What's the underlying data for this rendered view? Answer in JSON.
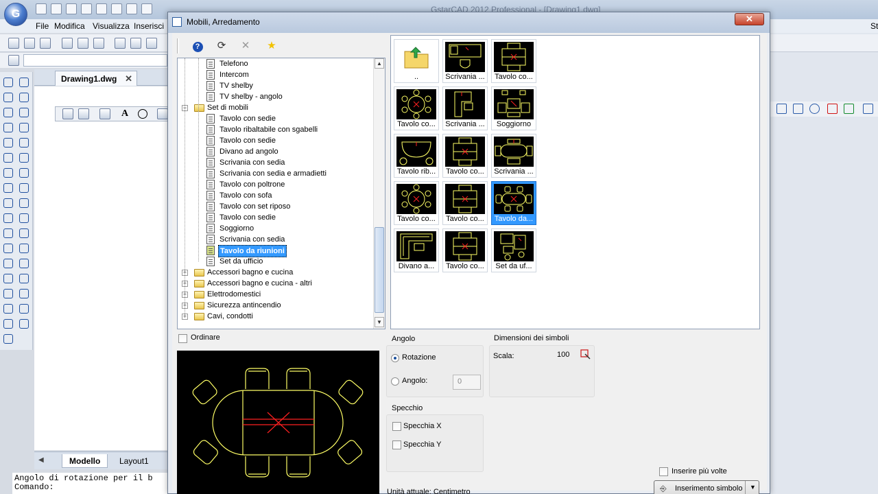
{
  "app": {
    "title": "GstarCAD 2012 Professional - [Drawing1.dwg]",
    "menu": [
      "File",
      "Modifica",
      "Visualizza",
      "Inserisci"
    ],
    "menu_right": "St",
    "doc_tab": "Drawing1.dwg",
    "doc_tab_close": "✕",
    "layout_tabs": [
      "Modello",
      "Layout1"
    ],
    "command_lines": [
      "Angolo di rotazione per il b",
      "Comando:"
    ]
  },
  "dialog": {
    "title": "Mobili, Arredamento",
    "close_label": "✕",
    "toolbar": {
      "help": "?",
      "reload": "⟳",
      "delete": "✕",
      "favorite": "★"
    },
    "tree": {
      "rows": [
        {
          "label": "Telefono",
          "type": "leaf",
          "level": 2
        },
        {
          "label": "Intercom",
          "type": "leaf",
          "level": 2
        },
        {
          "label": "TV shelby",
          "type": "leaf",
          "level": 2
        },
        {
          "label": "TV shelby - angolo",
          "type": "leaf",
          "level": 2
        },
        {
          "label": "Set di mobili",
          "type": "folder-open",
          "level": 1
        },
        {
          "label": "Tavolo con sedie",
          "type": "leaf",
          "level": 2
        },
        {
          "label": "Tavolo ribaltabile con sgabelli",
          "type": "leaf",
          "level": 2
        },
        {
          "label": "Tavolo con sedie",
          "type": "leaf",
          "level": 2
        },
        {
          "label": "Divano ad angolo",
          "type": "leaf",
          "level": 2
        },
        {
          "label": "Scrivania con sedia",
          "type": "leaf",
          "level": 2
        },
        {
          "label": "Scrivania con sedia e armadietti",
          "type": "leaf",
          "level": 2
        },
        {
          "label": "Tavolo con poltrone",
          "type": "leaf",
          "level": 2
        },
        {
          "label": "Tavolo con sofa",
          "type": "leaf",
          "level": 2
        },
        {
          "label": "Tavolo con set riposo",
          "type": "leaf",
          "level": 2
        },
        {
          "label": "Tavolo con sedie",
          "type": "leaf",
          "level": 2
        },
        {
          "label": "Soggiorno",
          "type": "leaf",
          "level": 2
        },
        {
          "label": "Scrivania con sedia",
          "type": "leaf",
          "level": 2
        },
        {
          "label": "Tavolo da riunioni",
          "type": "leaf",
          "level": 2,
          "selected": true
        },
        {
          "label": "Set da ufficio",
          "type": "leaf",
          "level": 2
        },
        {
          "label": "Accessori bagno e cucina",
          "type": "folder",
          "level": 1
        },
        {
          "label": "Accessori bagno e cucina - altri",
          "type": "folder",
          "level": 1
        },
        {
          "label": "Elettrodomestici",
          "type": "folder",
          "level": 1
        },
        {
          "label": "Sicurezza antincendio",
          "type": "folder",
          "level": 1
        },
        {
          "label": "Cavi, condotti",
          "type": "folder",
          "level": 1
        }
      ],
      "expander_plus": "+",
      "expander_minus": "−"
    },
    "ordinare_label": "Ordinare",
    "thumbnails": [
      {
        "label": "..",
        "kind": "up-folder"
      },
      {
        "label": "Scrivania ...",
        "kind": "desk"
      },
      {
        "label": "Tavolo co...",
        "kind": "table"
      },
      {
        "label": "Tavolo co...",
        "kind": "round"
      },
      {
        "label": "Scrivania ...",
        "kind": "desk2"
      },
      {
        "label": "Soggiorno",
        "kind": "living"
      },
      {
        "label": "Tavolo rib...",
        "kind": "fold"
      },
      {
        "label": "Tavolo co...",
        "kind": "table"
      },
      {
        "label": "Scrivania ...",
        "kind": "oval"
      },
      {
        "label": "Tavolo co...",
        "kind": "round"
      },
      {
        "label": "Tavolo co...",
        "kind": "table"
      },
      {
        "label": "Tavolo da...",
        "kind": "meeting",
        "selected": true
      },
      {
        "label": "Divano a...",
        "kind": "sofa"
      },
      {
        "label": "Tavolo co...",
        "kind": "table"
      },
      {
        "label": "Set da uf...",
        "kind": "office"
      }
    ],
    "angolo": {
      "title": "Angolo",
      "rotazione_label": "Rotazione",
      "angolo_label": "Angolo:",
      "angolo_value": "0",
      "selected": "rotazione"
    },
    "dimensioni": {
      "title": "Dimensioni dei simboli",
      "scala_label": "Scala:",
      "scala_value": "100"
    },
    "specchio": {
      "title": "Specchio",
      "x_label": "Specchia X",
      "y_label": "Specchia Y"
    },
    "unita_label": "Unità attuale: Centimetro",
    "inserire_label": "Inserire più volte",
    "insert_button_label": "Inserimento simbolo",
    "colors": {
      "selection": "#3399ff",
      "cad_yellow": "#ffff66",
      "cad_red": "#ff2020",
      "cad_bg": "#000000"
    }
  }
}
